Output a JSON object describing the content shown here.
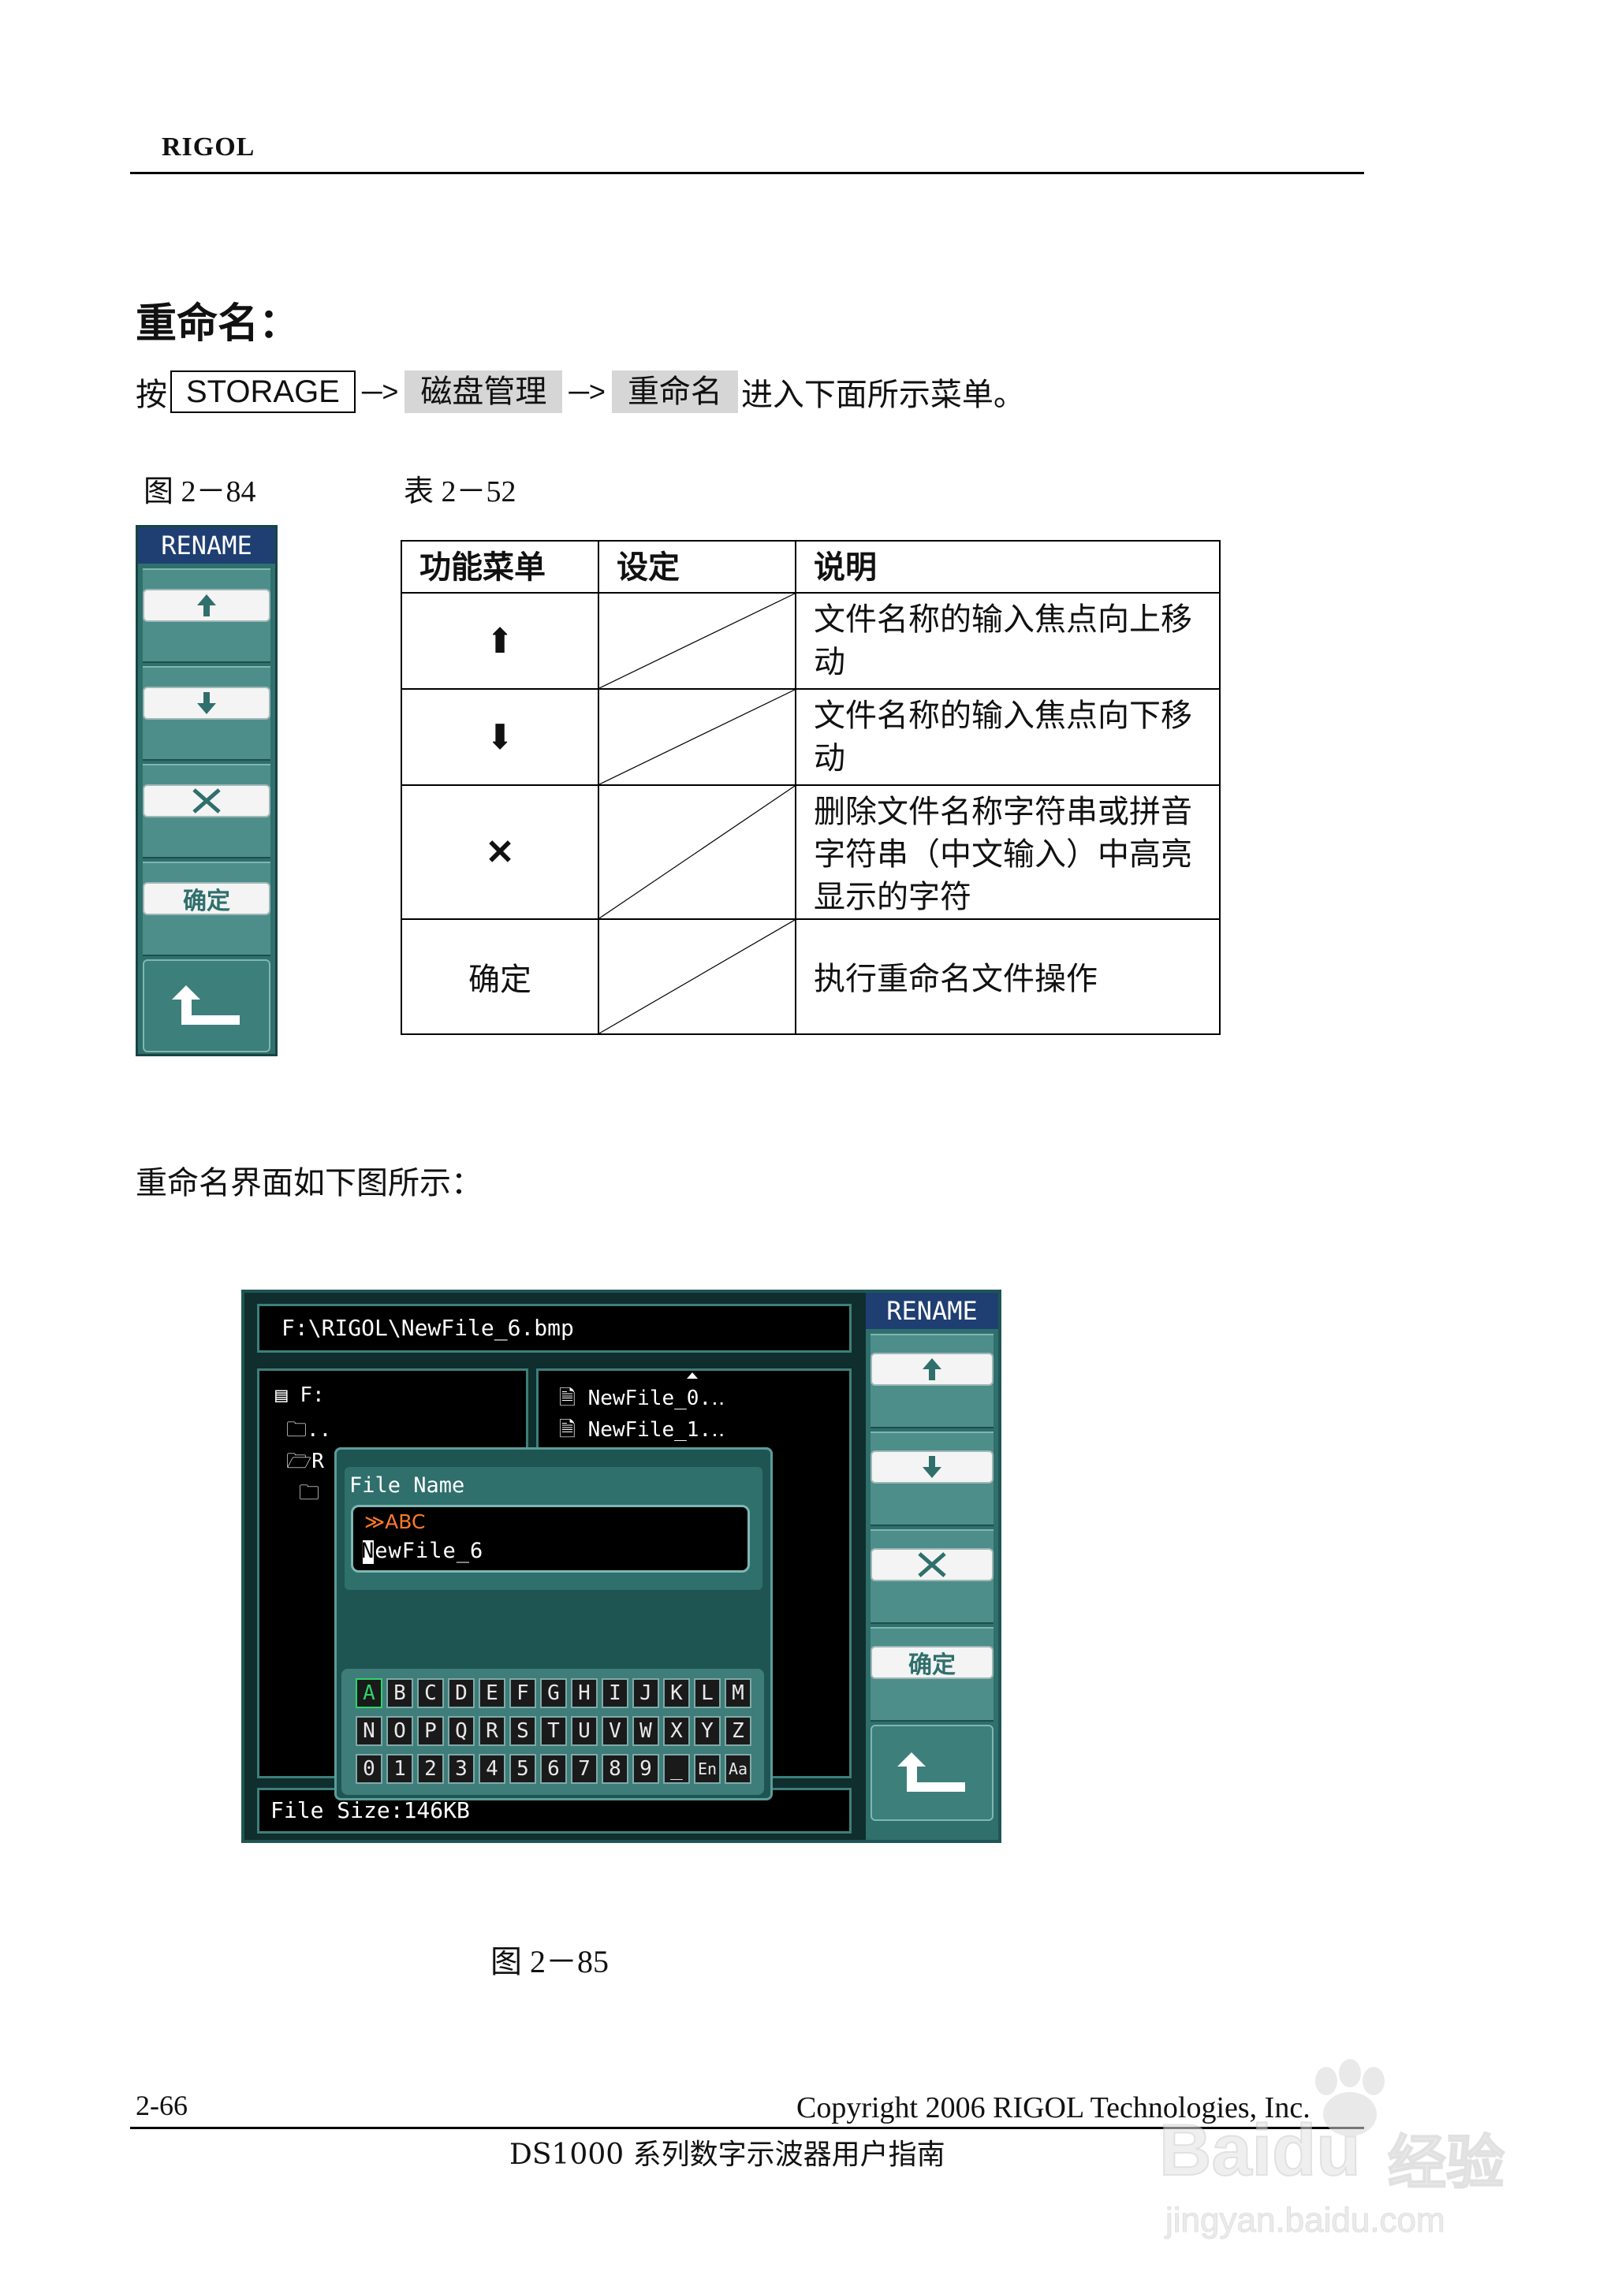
{
  "header": {
    "brand": "RIGOL"
  },
  "section": {
    "title": "重命名：",
    "intro": {
      "prefix": "按",
      "key": "STORAGE",
      "arrow1": "─>",
      "softkey1": "磁盘管理",
      "arrow2": "─>",
      "softkey2": "重命名",
      "suffix": "进入下面所示菜单。"
    },
    "figure_caption": "图 2－84",
    "table_caption": "表 2－52"
  },
  "menu": {
    "title": "RENAME",
    "up_icon": "arrow-up",
    "down_icon": "arrow-down",
    "delete_icon": "cross",
    "confirm_label": "确定",
    "back_icon": "return-arrow"
  },
  "table": {
    "headers": [
      "功能菜单",
      "设定",
      "说明"
    ],
    "rows": [
      {
        "menu_icon": "⬆",
        "desc": "文件名称的输入焦点向上移动"
      },
      {
        "menu_icon": "⬇",
        "desc": "文件名称的输入焦点向下移动"
      },
      {
        "menu_icon": "✕",
        "desc": "删除文件名称字符串或拼音字符串（中文输入）中高亮显示的字符"
      },
      {
        "menu_label": "确定",
        "desc": "执行重命名文件操作"
      }
    ]
  },
  "rename_ui_caption": "重命名界面如下图所示：",
  "screen": {
    "path": "F:\\RIGOL\\NewFile_6.bmp",
    "tree": [
      "F:",
      "..",
      "R",
      ""
    ],
    "files": [
      "NewFile_0.‥",
      "NewFile_1.‥"
    ],
    "dialog_title": "File Name",
    "input_mode": "ABC",
    "filename": "NewFile_6",
    "keyboard": [
      [
        "A",
        "B",
        "C",
        "D",
        "E",
        "F",
        "G",
        "H",
        "I",
        "J",
        "K",
        "L",
        "M"
      ],
      [
        "N",
        "O",
        "P",
        "Q",
        "R",
        "S",
        "T",
        "U",
        "V",
        "W",
        "X",
        "Y",
        "Z"
      ],
      [
        "0",
        "1",
        "2",
        "3",
        "4",
        "5",
        "6",
        "7",
        "8",
        "9",
        "_",
        "En",
        "Aa"
      ]
    ],
    "file_size": "File Size:146KB",
    "menu_title": "RENAME",
    "menu_confirm": "确定",
    "colors": {
      "screen_bg": "#0f2e2d",
      "dialog_bg": "#2f6f6c",
      "highlight": "#2fd46a",
      "mode": "#ff7a2a"
    }
  },
  "figure2_caption": "图 2－85",
  "footer": {
    "page": "2-66",
    "copyright": "Copyright 2006 RIGOL Technologies, Inc.",
    "doc": "DS1000 系列数字示波器用户指南"
  },
  "watermark": {
    "text1": "Baidu",
    "text2": "经验",
    "url": "jingyan.baidu.com"
  }
}
